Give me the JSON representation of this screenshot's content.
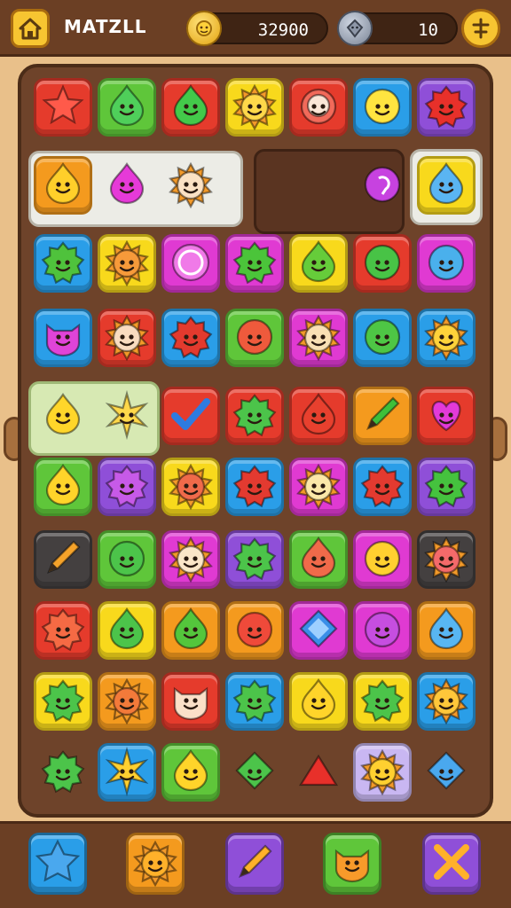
{
  "header": {
    "title": "MATZLL",
    "coins": "32900",
    "gems": "10",
    "home_icon": "home-icon",
    "settings_icon": "settings-icon"
  },
  "colors": {
    "red": "#e53b2c",
    "green": "#5fc63a",
    "orange": "#f49a1e",
    "yellow": "#f8d91c",
    "blue": "#2a9ee8",
    "purple": "#8f4fd8",
    "magenta": "#e03ad2",
    "gray": "#444040",
    "board": "#6e432a",
    "frame": "#e9c08a"
  },
  "tiles": [
    {
      "r": 0,
      "c": 0,
      "bg": "red",
      "icon": "star",
      "ic": "#ff5a4a"
    },
    {
      "r": 0,
      "c": 1,
      "bg": "green",
      "icon": "drop",
      "ic": "#4fcf5a"
    },
    {
      "r": 0,
      "c": 2,
      "bg": "red",
      "icon": "drop",
      "ic": "#43c94a"
    },
    {
      "r": 0,
      "c": 3,
      "bg": "yellow",
      "icon": "sun",
      "ic": "#ffd84a"
    },
    {
      "r": 0,
      "c": 4,
      "bg": "red",
      "icon": "face",
      "ic": "#f26a5a"
    },
    {
      "r": 0,
      "c": 5,
      "bg": "blue",
      "icon": "round",
      "ic": "#ffe440"
    },
    {
      "r": 0,
      "c": 6,
      "bg": "purple",
      "icon": "spiky",
      "ic": "#e8302a"
    },
    {
      "r": 1,
      "c": 0,
      "bg": "orange",
      "icon": "drop",
      "ic": "#ffcf2a"
    },
    {
      "r": 1,
      "c": 1,
      "bg": "none",
      "icon": "drop",
      "ic": "#e63ad8"
    },
    {
      "r": 1,
      "c": 2,
      "bg": "none",
      "icon": "sun",
      "ic": "#fbe2c4"
    },
    {
      "r": 1,
      "c": 5,
      "bg": "none",
      "icon": "swirl",
      "ic": "#c742e0"
    },
    {
      "r": 1,
      "c": 6,
      "bg": "yellow",
      "icon": "drop",
      "ic": "#5ab5f2"
    },
    {
      "r": 2,
      "c": 0,
      "bg": "blue",
      "icon": "spiky",
      "ic": "#4fc23c"
    },
    {
      "r": 2,
      "c": 1,
      "bg": "yellow",
      "icon": "sun",
      "ic": "#f79a3a"
    },
    {
      "r": 2,
      "c": 2,
      "bg": "magenta",
      "icon": "ring",
      "ic": "#f07ae8"
    },
    {
      "r": 2,
      "c": 3,
      "bg": "magenta",
      "icon": "spiky",
      "ic": "#4bc43a"
    },
    {
      "r": 2,
      "c": 4,
      "bg": "yellow",
      "icon": "drop",
      "ic": "#66cc3a"
    },
    {
      "r": 2,
      "c": 5,
      "bg": "red",
      "icon": "round",
      "ic": "#48c346"
    },
    {
      "r": 2,
      "c": 6,
      "bg": "magenta",
      "icon": "round",
      "ic": "#4ab0ec"
    },
    {
      "r": 3,
      "c": 0,
      "bg": "blue",
      "icon": "cat",
      "ic": "#e044d8"
    },
    {
      "r": 3,
      "c": 1,
      "bg": "red",
      "icon": "sun",
      "ic": "#f9dcc0"
    },
    {
      "r": 3,
      "c": 2,
      "bg": "blue",
      "icon": "spiky",
      "ic": "#e33a2e"
    },
    {
      "r": 3,
      "c": 3,
      "bg": "green",
      "icon": "round",
      "ic": "#ef5a3c"
    },
    {
      "r": 3,
      "c": 4,
      "bg": "magenta",
      "icon": "sun",
      "ic": "#f9e0b4"
    },
    {
      "r": 3,
      "c": 5,
      "bg": "blue",
      "icon": "round",
      "ic": "#4ec645"
    },
    {
      "r": 3,
      "c": 6,
      "bg": "blue",
      "icon": "sun",
      "ic": "#ffd23a"
    },
    {
      "r": 4,
      "c": 0,
      "bg": "none",
      "icon": "drop",
      "ic": "#ffd62a"
    },
    {
      "r": 4,
      "c": 1,
      "bg": "none",
      "icon": "burst",
      "ic": "#ffd84a"
    },
    {
      "r": 4,
      "c": 2,
      "bg": "red",
      "icon": "check",
      "ic": "#2e7be0"
    },
    {
      "r": 4,
      "c": 3,
      "bg": "red",
      "icon": "spiky",
      "ic": "#4cc44a"
    },
    {
      "r": 4,
      "c": 4,
      "bg": "red",
      "icon": "drop",
      "ic": "#e8402e"
    },
    {
      "r": 4,
      "c": 5,
      "bg": "orange",
      "icon": "pencil",
      "ic": "#3fbf3a"
    },
    {
      "r": 4,
      "c": 6,
      "bg": "red",
      "icon": "heart",
      "ic": "#e33ad8"
    },
    {
      "r": 5,
      "c": 0,
      "bg": "green",
      "icon": "drop",
      "ic": "#ffd42a"
    },
    {
      "r": 5,
      "c": 1,
      "bg": "purple",
      "icon": "spiky",
      "ic": "#c75ae8"
    },
    {
      "r": 5,
      "c": 2,
      "bg": "yellow",
      "icon": "sun",
      "ic": "#f06a4a"
    },
    {
      "r": 5,
      "c": 3,
      "bg": "blue",
      "icon": "spiky",
      "ic": "#e33a30"
    },
    {
      "r": 5,
      "c": 4,
      "bg": "magenta",
      "icon": "sun",
      "ic": "#fbe8a8"
    },
    {
      "r": 5,
      "c": 5,
      "bg": "blue",
      "icon": "spiky",
      "ic": "#e33a30"
    },
    {
      "r": 5,
      "c": 6,
      "bg": "purple",
      "icon": "spiky",
      "ic": "#45c23e"
    },
    {
      "r": 6,
      "c": 0,
      "bg": "gray",
      "icon": "pencil",
      "ic": "#f5a32a"
    },
    {
      "r": 6,
      "c": 1,
      "bg": "green",
      "icon": "round",
      "ic": "#4cc44a"
    },
    {
      "r": 6,
      "c": 2,
      "bg": "magenta",
      "icon": "sun",
      "ic": "#fbe6c8"
    },
    {
      "r": 6,
      "c": 3,
      "bg": "purple",
      "icon": "spiky",
      "ic": "#4cc44a"
    },
    {
      "r": 6,
      "c": 4,
      "bg": "green",
      "icon": "drop",
      "ic": "#f06a4a"
    },
    {
      "r": 6,
      "c": 5,
      "bg": "magenta",
      "icon": "round",
      "ic": "#ffd030"
    },
    {
      "r": 6,
      "c": 6,
      "bg": "gray",
      "icon": "sun",
      "ic": "#f46a6a"
    },
    {
      "r": 7,
      "c": 0,
      "bg": "red",
      "icon": "spiky",
      "ic": "#f56a44"
    },
    {
      "r": 7,
      "c": 1,
      "bg": "yellow",
      "icon": "drop",
      "ic": "#4cc44a"
    },
    {
      "r": 7,
      "c": 2,
      "bg": "orange",
      "icon": "drop",
      "ic": "#54c63c"
    },
    {
      "r": 7,
      "c": 3,
      "bg": "orange",
      "icon": "round",
      "ic": "#ef4a3a"
    },
    {
      "r": 7,
      "c": 4,
      "bg": "magenta",
      "icon": "gem",
      "ic": "#3a8ee8"
    },
    {
      "r": 7,
      "c": 5,
      "bg": "magenta",
      "icon": "round",
      "ic": "#c64ee0"
    },
    {
      "r": 7,
      "c": 6,
      "bg": "orange",
      "icon": "drop",
      "ic": "#58b6f2"
    },
    {
      "r": 8,
      "c": 0,
      "bg": "yellow",
      "icon": "spiky",
      "ic": "#4cc44a"
    },
    {
      "r": 8,
      "c": 1,
      "bg": "orange",
      "icon": "sun",
      "ic": "#f37a3a"
    },
    {
      "r": 8,
      "c": 2,
      "bg": "red",
      "icon": "cat",
      "ic": "#fbe0c8"
    },
    {
      "r": 8,
      "c": 3,
      "bg": "blue",
      "icon": "spiky",
      "ic": "#4cc44a"
    },
    {
      "r": 8,
      "c": 4,
      "bg": "yellow",
      "icon": "drop",
      "ic": "#ffd42a"
    },
    {
      "r": 8,
      "c": 5,
      "bg": "yellow",
      "icon": "spiky",
      "ic": "#4cc44a"
    },
    {
      "r": 8,
      "c": 6,
      "bg": "blue",
      "icon": "sun",
      "ic": "#ffc73a"
    },
    {
      "r": 9,
      "c": 0,
      "bg": "none",
      "icon": "spiky",
      "ic": "#4cc44a"
    },
    {
      "r": 9,
      "c": 1,
      "bg": "blue",
      "icon": "burst",
      "ic": "#ffd030"
    },
    {
      "r": 9,
      "c": 2,
      "bg": "green",
      "icon": "drop",
      "ic": "#ffd42a"
    },
    {
      "r": 9,
      "c": 3,
      "bg": "none",
      "icon": "diamond",
      "ic": "#4cc44a"
    },
    {
      "r": 9,
      "c": 4,
      "bg": "none",
      "icon": "triangle",
      "ic": "#e8302a"
    },
    {
      "r": 9,
      "c": 5,
      "bg": "lilac",
      "icon": "sun",
      "ic": "#ffd030"
    },
    {
      "r": 9,
      "c": 6,
      "bg": "none",
      "icon": "diamond",
      "ic": "#4aa8ee"
    }
  ],
  "boosters": [
    {
      "name": "booster-gem",
      "bg": "blue",
      "icon": "starburst",
      "ic": "#4aa8ee"
    },
    {
      "name": "booster-sun",
      "bg": "orange",
      "icon": "sun",
      "ic": "#ffb12a"
    },
    {
      "name": "booster-pencil",
      "bg": "purple",
      "icon": "pencil",
      "ic": "#ffb12a"
    },
    {
      "name": "booster-face",
      "bg": "green",
      "icon": "cat",
      "ic": "#f89a2a"
    },
    {
      "name": "booster-cross",
      "bg": "purple",
      "icon": "cross",
      "ic": "#ffb12a"
    }
  ]
}
